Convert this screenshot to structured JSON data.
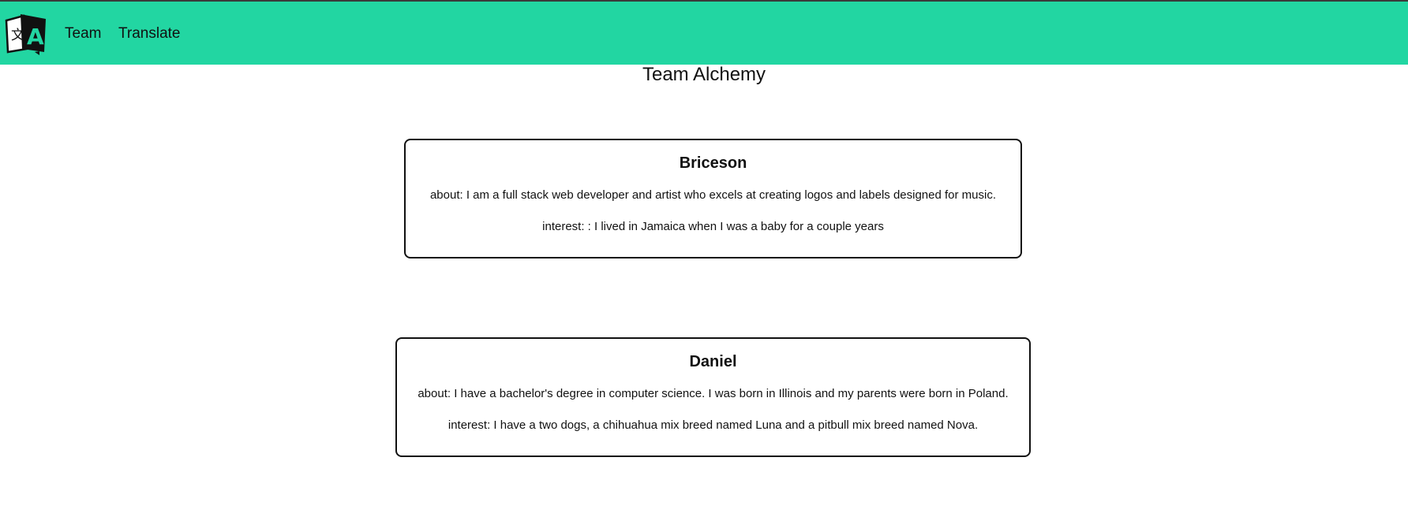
{
  "nav": {
    "logo_icon": "translate-icon",
    "links": [
      {
        "label": "Team"
      },
      {
        "label": "Translate"
      }
    ],
    "background": "#22d6a2"
  },
  "page": {
    "title": "Team Alchemy"
  },
  "members": [
    {
      "name": "Briceson",
      "about": "about: I am a full stack web developer and artist who excels at creating logos and labels designed for music.",
      "interest": "interest: : I lived in Jamaica when I was a baby for a couple years"
    },
    {
      "name": "Daniel",
      "about": "about: I have a bachelor's degree in computer science. I was born in Illinois and my parents were born in Poland.",
      "interest": "interest: I have a two dogs, a chihuahua mix breed named Luna and a pitbull mix breed named Nova."
    }
  ]
}
